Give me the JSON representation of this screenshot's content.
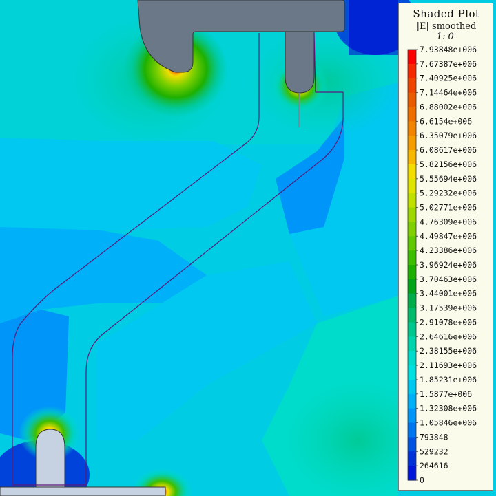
{
  "chart_data": {
    "type": "heatmap",
    "title": "Shaded Plot",
    "subtitle": "|E| smoothed",
    "annotation": "1: 0'",
    "colorbar": {
      "labels": [
        "7.93848e+006",
        "7.67387e+006",
        "7.40925e+006",
        "7.14464e+006",
        "6.88002e+006",
        "6.6154e+006",
        "6.35079e+006",
        "6.08617e+006",
        "5.82156e+006",
        "5.55694e+006",
        "5.29232e+006",
        "5.02771e+006",
        "4.76309e+006",
        "4.49847e+006",
        "4.23386e+006",
        "3.96924e+006",
        "3.70463e+006",
        "3.44001e+006",
        "3.17539e+006",
        "2.91078e+006",
        "2.64616e+006",
        "2.38155e+006",
        "2.11693e+006",
        "1.85231e+006",
        "1.5877e+006",
        "1.32308e+006",
        "1.05846e+006",
        "793848",
        "529232",
        "264616",
        "0"
      ],
      "values": [
        7938480,
        7673870,
        7409250,
        7144640,
        6880020,
        6615400,
        6350790,
        6086170,
        5821560,
        5556940,
        5292320,
        5027710,
        4763090,
        4498470,
        4233860,
        3969240,
        3704630,
        3440010,
        3175390,
        2910780,
        2646160,
        2381550,
        2116930,
        1852310,
        1587700,
        1323080,
        1058460,
        793848,
        529232,
        264616,
        0
      ],
      "colors": [
        "#ff0000",
        "#f52a00",
        "#ef4400",
        "#ea5a00",
        "#ee6e00",
        "#f28500",
        "#f49c00",
        "#f8b800",
        "#f4dd00",
        "#dfe400",
        "#c0e000",
        "#9ed800",
        "#80d000",
        "#5fc800",
        "#3ebe00",
        "#1eb000",
        "#00a419",
        "#00ad4a",
        "#00ba6c",
        "#00c78e",
        "#00d4ad",
        "#00dccc",
        "#00e0e0",
        "#00c8f0",
        "#00b0f8",
        "#0095f8",
        "#0075f0",
        "#0052e0",
        "#0030d8",
        "#0016d8",
        "#0000d0"
      ]
    }
  }
}
